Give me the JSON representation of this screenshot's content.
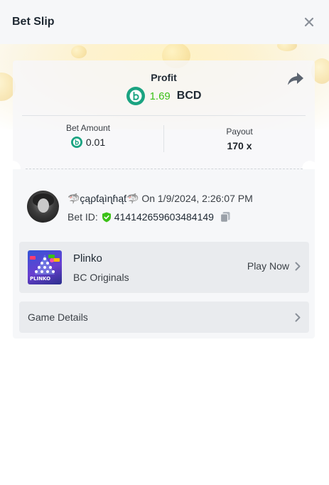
{
  "header": {
    "title": "Bet Slip"
  },
  "summary": {
    "profit_label": "Profit",
    "profit_value": "1.69",
    "profit_currency": "BCD",
    "bet_amount_label": "Bet Amount",
    "bet_amount_value": "0.01",
    "payout_label": "Payout",
    "payout_value": "170 x"
  },
  "bet": {
    "user_name": "🦈çąρƭąìɳɦąƭ🦈",
    "date_text": "On 1/9/2024, 2:26:07 PM",
    "bet_id_label": "Bet ID:",
    "bet_id_value": "414142659603484149"
  },
  "game": {
    "name": "Plinko",
    "provider": "BC Originals",
    "thumb_text": "PLINKO",
    "play_label": "Play Now"
  },
  "details": {
    "label": "Game Details"
  },
  "colors": {
    "accent_green": "#3bc117",
    "coin_teal": "#1aa381",
    "panel": "#f6f7f9"
  },
  "icons": {
    "close": "close-icon",
    "share": "share-icon",
    "coin": "bcd-coin-icon",
    "verified": "shield-check-icon",
    "copy": "copy-icon",
    "chevron": "chevron-right-icon"
  }
}
